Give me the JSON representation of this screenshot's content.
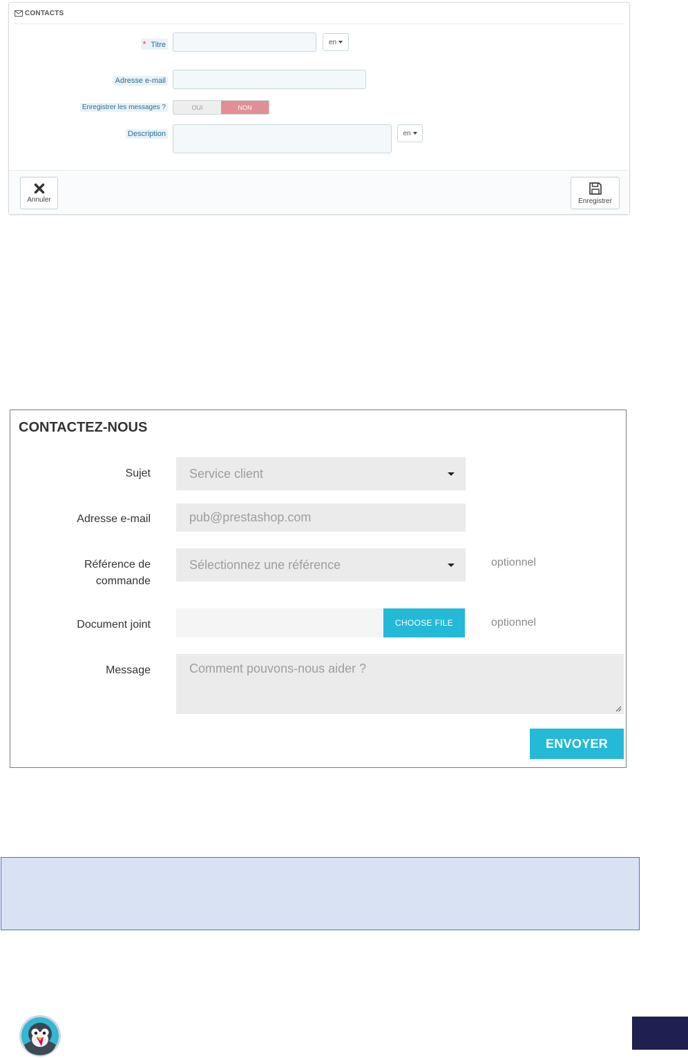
{
  "admin": {
    "heading": "CONTACTS",
    "fields": {
      "title_label": "Titre",
      "title_required": "*",
      "title_lang": "en",
      "email_label": "Adresse e-mail",
      "save_messages_label": "Enregistrer les messages ?",
      "switch_yes": "OUI",
      "switch_no": "NON",
      "switch_selected": "NON",
      "description_label": "Description",
      "description_lang": "en"
    },
    "footer": {
      "cancel_label": "Annuler",
      "save_label": "Enregistrer"
    }
  },
  "contact_form": {
    "title": "CONTACTEZ-NOUS",
    "subject": {
      "label": "Sujet",
      "value": "Service client"
    },
    "email": {
      "label": "Adresse e-mail",
      "placeholder": "pub@prestashop.com"
    },
    "order_ref": {
      "label_line1": "Référence de",
      "label_line2": "commande",
      "placeholder": "Sélectionnez une référence",
      "optional": "optionnel"
    },
    "attachment": {
      "label": "Document joint",
      "button": "CHOOSE FILE",
      "optional": "optionnel"
    },
    "message": {
      "label": "Message",
      "placeholder": "Comment pouvons-nous aider ?"
    },
    "submit": "ENVOYER"
  },
  "colors": {
    "accent": "#24b9d7",
    "switch_off": "#e08f95",
    "info_box_bg": "#d9e2f3",
    "info_box_border": "#4472c4",
    "corner_block": "#1f2050"
  },
  "icons": [
    "envelope-icon",
    "caret-down-icon",
    "close-icon",
    "floppy-disk-icon",
    "resize-grip-icon",
    "prestashop-logo"
  ]
}
